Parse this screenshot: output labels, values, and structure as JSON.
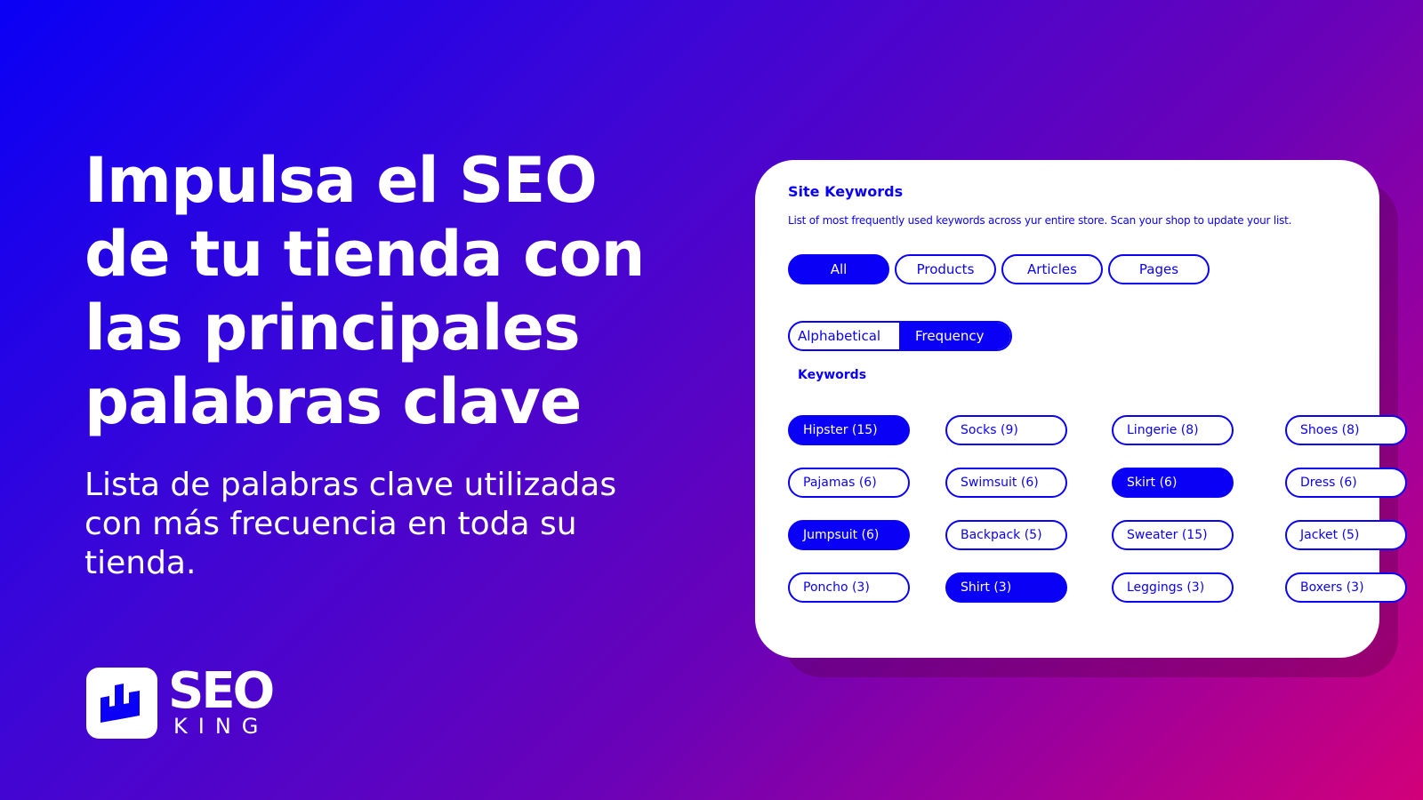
{
  "hero": {
    "headline_lines": [
      "Impulsa el SEO",
      "de tu tienda con",
      "las principales",
      "palabras clave"
    ],
    "subtitle_lines": [
      "Lista de palabras clave utilizadas",
      "con más frecuencia en toda su",
      "tienda."
    ]
  },
  "logo": {
    "icon": "bar-chart-crown-icon",
    "word_top": "SEO",
    "word_bottom": "KING"
  },
  "colors": {
    "accent": "#0a00f5",
    "gradient_start": "#0a00f5",
    "gradient_end": "#d2007a",
    "card_bg": "#ffffff"
  },
  "card": {
    "title": "Site Keywords",
    "description": "List of most frequently used keywords across yur entire store. Scan your shop to update your list.",
    "filters": [
      {
        "label": "All",
        "active": true
      },
      {
        "label": "Products",
        "active": false
      },
      {
        "label": "Articles",
        "active": false
      },
      {
        "label": "Pages",
        "active": false
      }
    ],
    "sort": [
      {
        "label": "Alphabetical",
        "active": false
      },
      {
        "label": "Frequency",
        "active": true
      }
    ],
    "keywords_label": "Keywords",
    "keywords": [
      {
        "label": "Hipster (15)",
        "active": true
      },
      {
        "label": "Socks (9)",
        "active": false
      },
      {
        "label": "Lingerie (8)",
        "active": false
      },
      {
        "label": "Shoes (8)",
        "active": false
      },
      {
        "label": "Pajamas (6)",
        "active": false
      },
      {
        "label": "Swimsuit (6)",
        "active": false
      },
      {
        "label": "Skirt (6)",
        "active": true
      },
      {
        "label": "Dress (6)",
        "active": false
      },
      {
        "label": "Jumpsuit (6)",
        "active": true
      },
      {
        "label": "Backpack (5)",
        "active": false
      },
      {
        "label": "Sweater (15)",
        "active": false
      },
      {
        "label": "Jacket (5)",
        "active": false
      },
      {
        "label": "Poncho (3)",
        "active": false
      },
      {
        "label": "Shirt (3)",
        "active": true
      },
      {
        "label": "Leggings (3)",
        "active": false
      },
      {
        "label": "Boxers (3)",
        "active": false
      }
    ]
  }
}
